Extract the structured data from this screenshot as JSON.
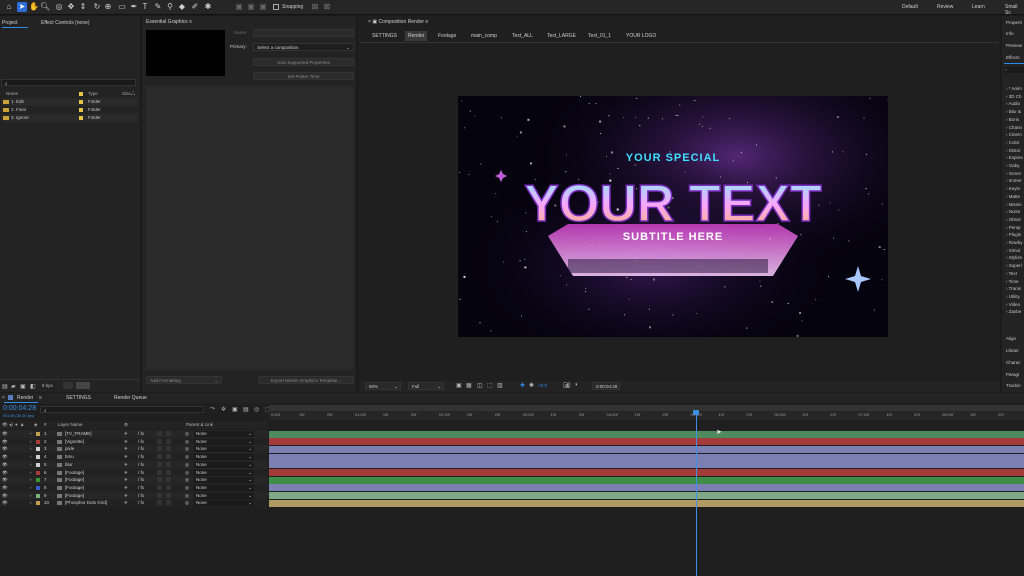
{
  "toolbar": {
    "snapping_label": "Snapping",
    "workspaces": [
      "Default",
      "Review",
      "Learn",
      "Small Sc"
    ]
  },
  "project_panel": {
    "tabs": [
      "Project",
      "Effect Controls (none)"
    ],
    "search_placeholder": "",
    "columns": [
      "Name",
      "Type",
      "Size"
    ],
    "items": [
      {
        "name": "1. Edit",
        "type": "Folder"
      },
      {
        "name": "2. Final",
        "type": "Folder"
      },
      {
        "name": "3. Ignore",
        "type": "Folder"
      }
    ],
    "bpc": "8 bpc"
  },
  "essential_graphics": {
    "title": "Essential Graphics",
    "name_label": "Name:",
    "primary_label": "Primary:",
    "primary_value": "Select a composition",
    "solo_btn": "Solo Supported Properties",
    "poster_btn": "Set Poster Time",
    "add_formatting": "Add Formatting",
    "export_btn": "Export Motion Graphics Template..."
  },
  "composition": {
    "panel_title": "Composition Render",
    "tabs": [
      "SETTINGS",
      "Render",
      "Footage",
      "main_comp",
      "Text_ALL",
      "Text_LARGE",
      "Text_01_1",
      "YOUR LOGO"
    ],
    "active_tab": "Render",
    "artwork": {
      "line1": "YOUR SPECIAL",
      "line2": "YOUR TEXT",
      "line3": "SUBTITLE HERE"
    },
    "zoom": "50%",
    "resolution": "Full",
    "exposure": "+0.0",
    "timecode": "0:00:04:28"
  },
  "right_panels": {
    "top": [
      "Properti",
      "Info",
      "Preview",
      "Effects"
    ],
    "effects": [
      "* Anim",
      "3D Ch",
      "Audio",
      "Blur &",
      "Boris",
      "Chann",
      "Cinem",
      "Color",
      "Distor",
      "Expres",
      "Gaby",
      "Gener",
      "Immer",
      "Keyin",
      "Matte",
      "Missin",
      "Noise",
      "Obsol",
      "Persp",
      "Plugin",
      "Rowby",
      "Simul",
      "Stylize",
      "Superl",
      "Text",
      "Time",
      "Transi",
      "Utility",
      "Video",
      "Zaxbe"
    ],
    "bottom": [
      "Align",
      "Librari",
      "Charac",
      "Paragr",
      "Trackin"
    ]
  },
  "timeline": {
    "tabs": [
      "Render",
      "SETTINGS",
      "Render Queue"
    ],
    "timecode": "0:00:04:28",
    "frames": "00149 (30.00 fps)",
    "col_source": "Layer Name",
    "col_parent": "Parent & Link",
    "ruler": [
      "0:00f",
      "10f",
      "20f",
      "01:00f",
      "10f",
      "20f",
      "02:00f",
      "10f",
      "20f",
      "03:00f",
      "10f",
      "20f",
      "04:00f",
      "10f",
      "20f",
      "05:00f",
      "10f",
      "20f",
      "06:00f",
      "10f",
      "20f",
      "07:00f",
      "10f",
      "20f",
      "08:00f",
      "10f",
      "20f"
    ],
    "layers": [
      {
        "num": "1",
        "name": "[TV_FRAME]",
        "parent": "None",
        "color": "#c0a050"
      },
      {
        "num": "2",
        "name": "[Vignette]",
        "parent": "None",
        "color": "#a83a3a"
      },
      {
        "num": "3",
        "name": "pixle",
        "parent": "None",
        "color": "#d0d0d0"
      },
      {
        "num": "4",
        "name": "bmu",
        "parent": "None",
        "color": "#d0d0d0"
      },
      {
        "num": "5",
        "name": "blur",
        "parent": "None",
        "color": "#d0d0d0"
      },
      {
        "num": "6",
        "name": "[Footage]",
        "parent": "None",
        "color": "#a83a3a"
      },
      {
        "num": "7",
        "name": "[Footage]",
        "parent": "None",
        "color": "#3a9a3a"
      },
      {
        "num": "8",
        "name": "[Footage]",
        "parent": "None",
        "color": "#3a5ac8"
      },
      {
        "num": "9",
        "name": "[Footage]",
        "parent": "None",
        "color": "#7ab07a"
      },
      {
        "num": "10",
        "name": "[Phosphor Dots Grid]",
        "parent": "None",
        "color": "#c0a050"
      }
    ],
    "bar_colors": [
      "#4f8a5e",
      "#a43b3b",
      "#7b7fb1",
      "#7b7fb1",
      "#7b7fb1",
      "#a43b3b",
      "#3e8e48",
      "#7b7fb1",
      "#7fa886",
      "#b09a63"
    ],
    "playhead_fraction": 0.565
  }
}
